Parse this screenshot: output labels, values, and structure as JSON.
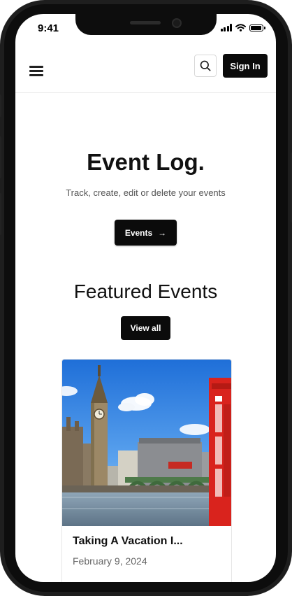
{
  "status": {
    "time": "9:41"
  },
  "nav": {
    "signin_label": "Sign In"
  },
  "hero": {
    "title": "Event Log.",
    "subtitle": "Track, create, edit or delete your events",
    "events_button": "Events",
    "events_arrow": "→"
  },
  "featured": {
    "title": "Featured Events",
    "view_all": "View all"
  },
  "event_cards": [
    {
      "title": "Taking A Vacation I...",
      "date": "February 9, 2024",
      "image": "london-big-ben-photo"
    }
  ],
  "icons": [
    "menu-icon",
    "search-icon",
    "signal-icon",
    "wifi-icon",
    "battery-icon",
    "arrow-right-icon"
  ],
  "colors": {
    "primary_button": "#0b0b0b",
    "button_text": "#ffffff",
    "text": "#111111",
    "muted": "#555555"
  }
}
